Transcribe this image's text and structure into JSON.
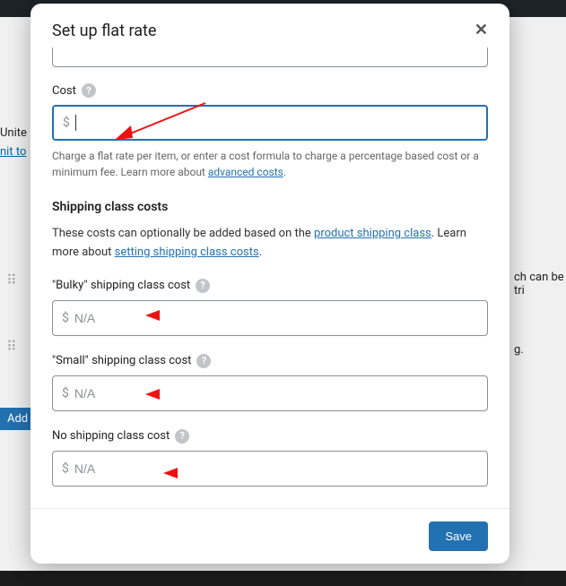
{
  "modal": {
    "title": "Set up flat rate",
    "close_label": "✕"
  },
  "cost": {
    "label": "Cost",
    "currency": "$",
    "value": "",
    "help_prefix": "Charge a flat rate per item, or enter a cost formula to charge a percentage based cost or a minimum fee. Learn more about ",
    "help_link": "advanced costs",
    "help_suffix": "."
  },
  "shipping_classes": {
    "heading": "Shipping class costs",
    "desc_parts": {
      "p1": "These costs can optionally be added based on the ",
      "link1": "product shipping class",
      "p2": ". Learn more about ",
      "link2": "setting shipping class costs",
      "p3": "."
    },
    "items": [
      {
        "label": "\"Bulky\" shipping class cost",
        "placeholder": "N/A"
      },
      {
        "label": "\"Small\" shipping class cost",
        "placeholder": "N/A"
      },
      {
        "label": "No shipping class cost",
        "placeholder": "N/A"
      }
    ]
  },
  "footer": {
    "save_label": "Save"
  },
  "background": {
    "text1": "ch can be tri",
    "text2": "g.",
    "text3": "Unite",
    "link": "nit to",
    "button": "Add s"
  },
  "help_glyph": "?"
}
